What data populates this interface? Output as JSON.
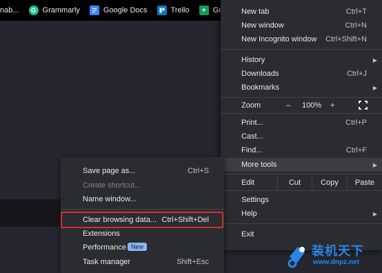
{
  "bookmarks": [
    {
      "label": "nab...",
      "icon": "none"
    },
    {
      "label": "Grammarly",
      "icon": "grammarly-icon"
    },
    {
      "label": "Google Docs",
      "icon": "google-docs-icon"
    },
    {
      "label": "Trello",
      "icon": "trello-icon"
    },
    {
      "label": "Goo",
      "icon": "google-sheets-icon"
    }
  ],
  "menu": {
    "new_tab": {
      "label": "New tab",
      "shortcut": "Ctrl+T"
    },
    "new_window": {
      "label": "New window",
      "shortcut": "Ctrl+N"
    },
    "new_incognito": {
      "label": "New Incognito window",
      "shortcut": "Ctrl+Shift+N"
    },
    "history": {
      "label": "History"
    },
    "downloads": {
      "label": "Downloads",
      "shortcut": "Ctrl+J"
    },
    "bookmarks": {
      "label": "Bookmarks"
    },
    "zoom": {
      "label": "Zoom",
      "minus": "–",
      "value": "100%",
      "plus": "+"
    },
    "print": {
      "label": "Print...",
      "shortcut": "Ctrl+P"
    },
    "cast": {
      "label": "Cast..."
    },
    "find": {
      "label": "Find...",
      "shortcut": "Ctrl+F"
    },
    "more_tools": {
      "label": "More tools"
    },
    "edit": {
      "label": "Edit",
      "cut": "Cut",
      "copy": "Copy",
      "paste": "Paste"
    },
    "settings": {
      "label": "Settings"
    },
    "help": {
      "label": "Help"
    },
    "exit": {
      "label": "Exit"
    }
  },
  "submenu": {
    "save_page": {
      "label": "Save page as...",
      "shortcut": "Ctrl+S"
    },
    "create_shortcut": {
      "label": "Create shortcut..."
    },
    "name_window": {
      "label": "Name window..."
    },
    "clear_data": {
      "label": "Clear browsing data...",
      "shortcut": "Ctrl+Shift+Del"
    },
    "extensions": {
      "label": "Extensions"
    },
    "performance": {
      "label": "Performance",
      "badge": "New"
    },
    "task_manager": {
      "label": "Task manager",
      "shortcut": "Shift+Esc"
    }
  },
  "watermark": {
    "title": "装机天下",
    "url": "www.dnpz.net"
  },
  "colors": {
    "highlight_box": "#d33030",
    "badge": "#8ab4f8",
    "menu_bg": "#2b2c30"
  }
}
